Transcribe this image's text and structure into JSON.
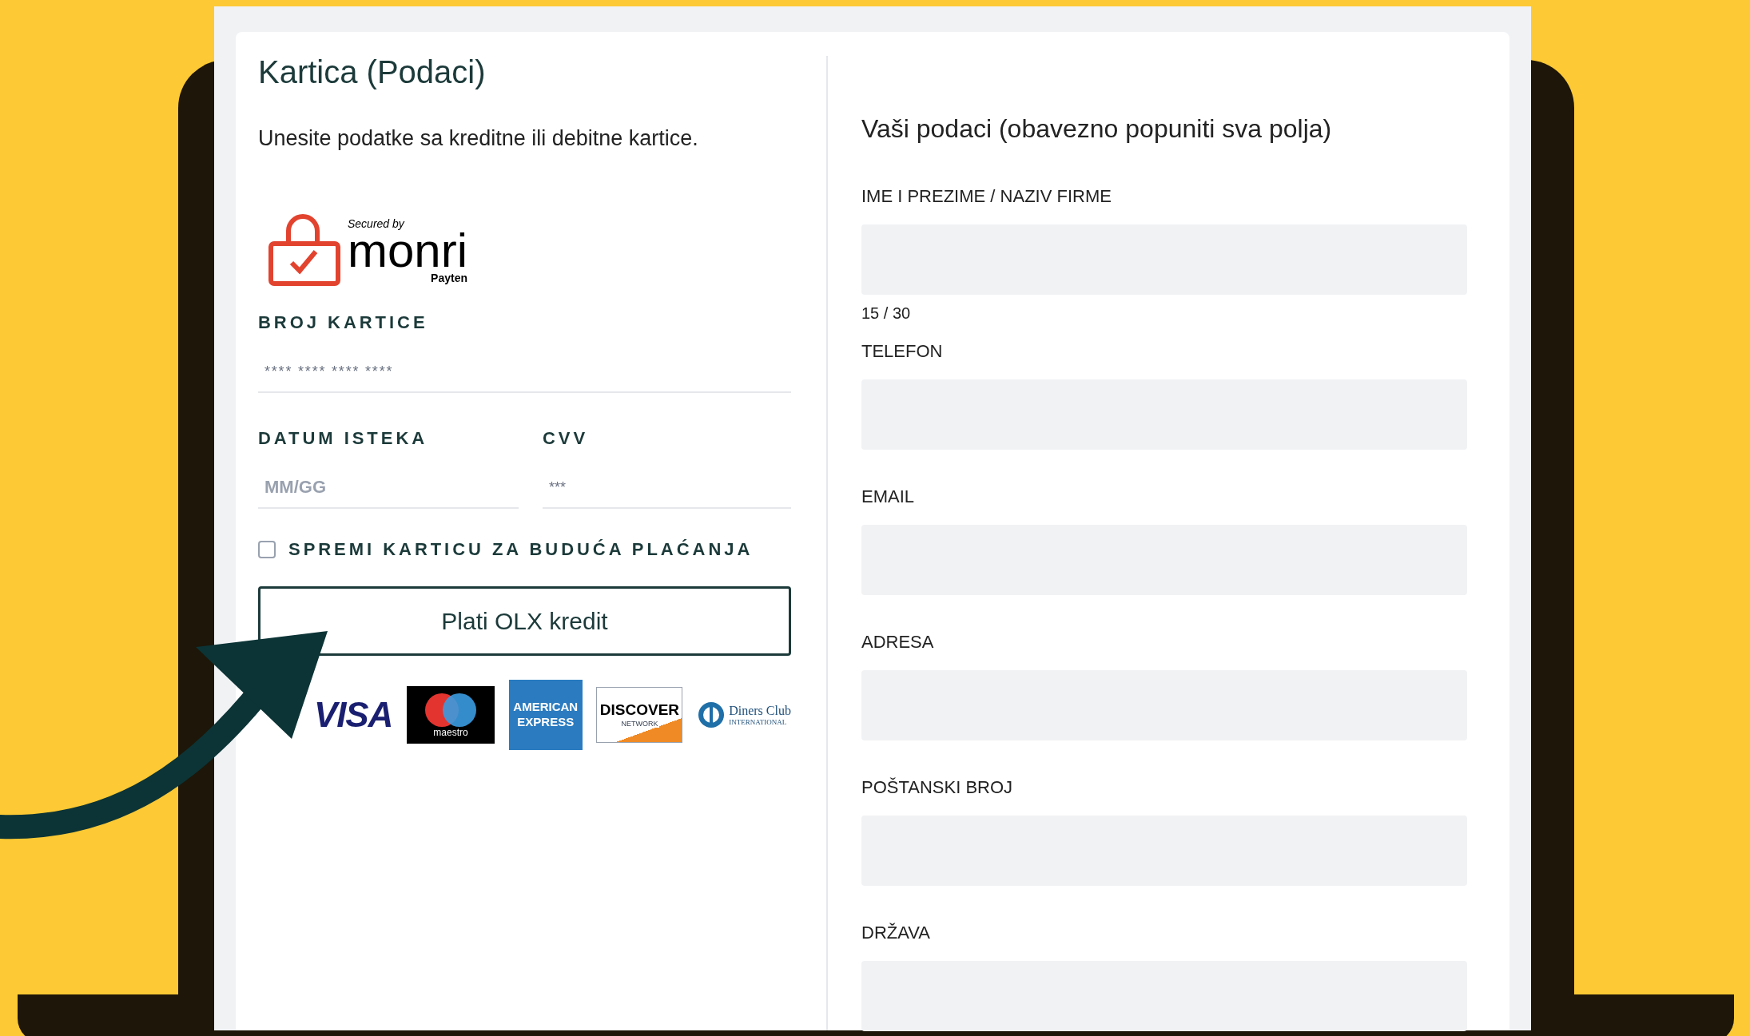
{
  "card": {
    "title": "Kartica (Podaci)",
    "subtitle": "Unesite podatke sa kreditne ili debitne kartice.",
    "secure_logo": {
      "secured_by": "Secured by",
      "brand": "monri",
      "partner": "Payten"
    },
    "card_number": {
      "label": "BROJ KARTICE",
      "placeholder": "**** **** **** ****"
    },
    "expiry": {
      "label": "DATUM ISTEKA",
      "placeholder": "MM/GG"
    },
    "cvv": {
      "label": "CVV",
      "placeholder": "***"
    },
    "save_card": {
      "label": "SPREMI KARTICU ZA BUDUĆA PLAĆANJA",
      "checked": false
    },
    "pay_button": "Plati OLX kredit",
    "card_logos": [
      {
        "kind": "visa",
        "text": "VISA"
      },
      {
        "kind": "maestro",
        "text": "maestro"
      },
      {
        "kind": "amex",
        "text": "AMERICAN EXPRESS"
      },
      {
        "kind": "discover",
        "text": "DISCOVER",
        "subtext": "NETWORK"
      },
      {
        "kind": "diners",
        "text": "Diners Club",
        "subtext": "INTERNATIONAL"
      }
    ]
  },
  "details": {
    "title": "Vaši podaci (obavezno popuniti sva polja)",
    "fields": [
      {
        "label": "IME I PREZIME / NAZIV FIRME",
        "counter": "15 / 30"
      },
      {
        "label": "TELEFON"
      },
      {
        "label": "EMAIL"
      },
      {
        "label": "ADRESA"
      },
      {
        "label": "POŠTANSKI BROJ"
      },
      {
        "label": "DRŽAVA"
      }
    ]
  }
}
